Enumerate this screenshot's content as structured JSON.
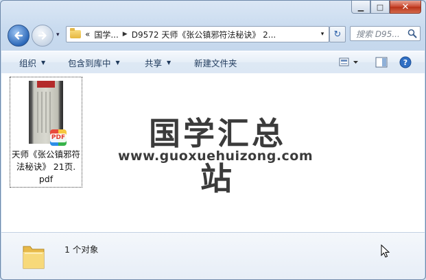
{
  "window": {
    "minimize": "▁",
    "maximize": "□",
    "close": "✕"
  },
  "nav": {
    "history_caret": "▾",
    "address": {
      "chevrons": "«",
      "crumbs": [
        "国学...",
        "D9572 天师《张公镇邪符法秘诀》 2..."
      ],
      "dropdown": "▾"
    },
    "refresh": "↻",
    "search_placeholder": "搜索 D95..."
  },
  "toolbar": {
    "organize": "组织",
    "include_in_library": "包含到库中",
    "share": "共享",
    "new_folder": "新建文件夹"
  },
  "file": {
    "name_line1": "天师《张公镇邪符",
    "name_line2": "法秘诀》 21页.",
    "name_line3": "pdf",
    "badge": "PDF",
    "thumb_label": "PDF"
  },
  "watermark": {
    "title": "国学汇总站",
    "url": "www.guoxuehuizong.com"
  },
  "status": {
    "count": "1 个对象"
  },
  "colors": {
    "accent": "#2d69b9",
    "close_red": "#c8452c",
    "toolbar_text": "#1e395b"
  }
}
